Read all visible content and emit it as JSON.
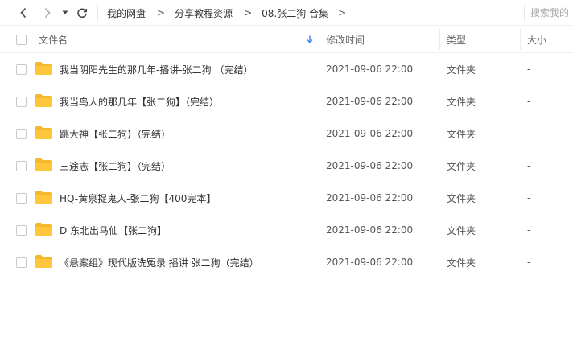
{
  "toolbar": {
    "breadcrumbs": [
      "我的网盘",
      "分享教程资源",
      "08.张二狗 合集"
    ],
    "separator": ">",
    "search_placeholder": "搜索我的"
  },
  "header": {
    "name": "文件名",
    "modified": "修改时间",
    "type": "类型",
    "size": "大小"
  },
  "files": [
    {
      "name": "我当阴阳先生的那几年-播讲-张二狗 （完结）",
      "modified": "2021-09-06 22:00",
      "type": "文件夹",
      "size": "-"
    },
    {
      "name": "我当鸟人的那几年【张二狗】（完结）",
      "modified": "2021-09-06 22:00",
      "type": "文件夹",
      "size": "-"
    },
    {
      "name": "跳大神【张二狗】（完结）",
      "modified": "2021-09-06 22:00",
      "type": "文件夹",
      "size": "-"
    },
    {
      "name": "三途志【张二狗】（完结）",
      "modified": "2021-09-06 22:00",
      "type": "文件夹",
      "size": "-"
    },
    {
      "name": "HQ-黄泉捉鬼人-张二狗【400完本】",
      "modified": "2021-09-06 22:00",
      "type": "文件夹",
      "size": "-"
    },
    {
      "name": "D 东北出马仙【张二狗】",
      "modified": "2021-09-06 22:00",
      "type": "文件夹",
      "size": "-"
    },
    {
      "name": "《悬案组》现代版洗冤录  播讲 张二狗（完结）",
      "modified": "2021-09-06 22:00",
      "type": "文件夹",
      "size": "-"
    }
  ],
  "colors": {
    "folder": "#ffc53d",
    "folder_tab": "#f5b72b",
    "sort_arrow": "#3d8af7"
  }
}
